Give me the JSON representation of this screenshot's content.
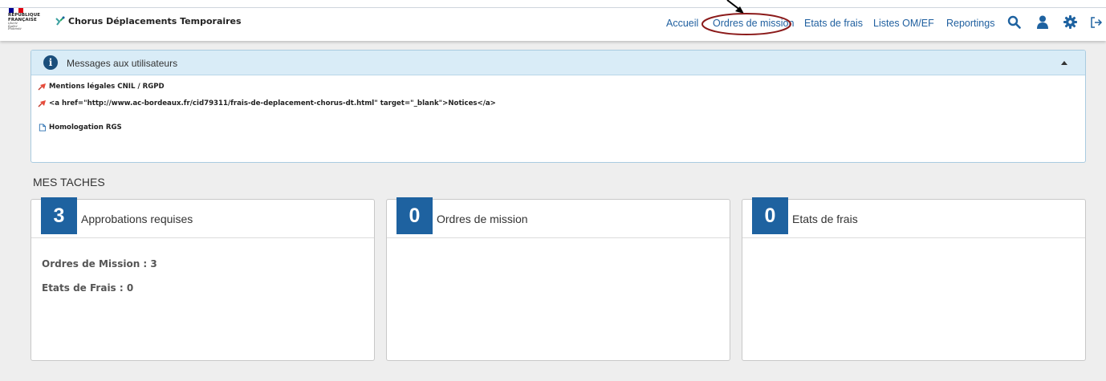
{
  "header": {
    "republic": [
      "RÉPUBLIQUE",
      "FRANÇAISE"
    ],
    "motto": [
      "Liberté",
      "Égalité",
      "Fraternité"
    ],
    "app_title": "Chorus Déplacements Temporaires",
    "nav": {
      "accueil": "Accueil",
      "ordres": "Ordres de mission",
      "etats": "Etats de frais",
      "listes": "Listes OM/EF",
      "reportings": "Reportings"
    },
    "icons": [
      "search-icon",
      "user-icon",
      "gear-icon",
      "logout-icon"
    ],
    "colors": {
      "nav": "#1f5f9f",
      "accent": "#1e62a0",
      "annotation": "#8b1a1a"
    }
  },
  "messages": {
    "title": "Messages aux utilisateurs",
    "items": [
      "Mentions légales CNIL / RGPD",
      "<a href=\"http://www.ac-bordeaux.fr/cid79311/frais-de-deplacement-chorus-dt.html\" target=\"_blank\">Notices</a>",
      "Homologation RGS"
    ]
  },
  "tasks": {
    "section_title": "MES TACHES",
    "cards": [
      {
        "count": "3",
        "title": "Approbations requises",
        "lines": [
          "Ordres de Mission : 3",
          "Etats de Frais : 0"
        ]
      },
      {
        "count": "0",
        "title": "Ordres de mission"
      },
      {
        "count": "0",
        "title": "Etats de frais"
      }
    ]
  }
}
